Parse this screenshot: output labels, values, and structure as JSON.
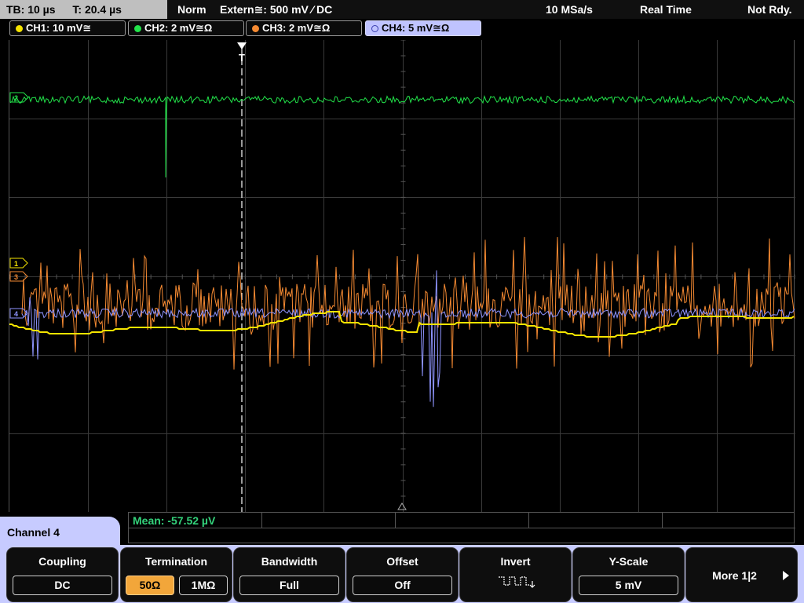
{
  "status": {
    "timebase": "TB: 10 µs",
    "trigger_time": "T: 20.4 µs",
    "mode": "Norm",
    "trigger_source": "Extern≅: 500 mV ⁄ DC",
    "sample_rate": "10 MSa/s",
    "acq_mode": "Real Time",
    "ready_state": "Not Rdy."
  },
  "channels": [
    {
      "label": "CH1: 10 mV≅",
      "color": "#f5e400"
    },
    {
      "label": "CH2: 2 mV≅Ω",
      "color": "#22e34a"
    },
    {
      "label": "CH3: 2 mV≅Ω",
      "color": "#f58a32"
    },
    {
      "label": "CH4: 5 mV≅Ω",
      "color": "#8f95ff"
    }
  ],
  "trace_markers": {
    "ch2": "2",
    "ch1": "1",
    "ch3": "3",
    "ch4": "4",
    "trigger": "T"
  },
  "measurement": {
    "mean": "Mean: -57.52 µV"
  },
  "panel": {
    "title": "Channel 4"
  },
  "softkeys": {
    "coupling": {
      "title": "Coupling",
      "value": "DC"
    },
    "termination": {
      "title": "Termination",
      "opt1": "50Ω",
      "opt2": "1MΩ"
    },
    "bandwidth": {
      "title": "Bandwidth",
      "value": "Full"
    },
    "offset": {
      "title": "Offset",
      "value": "Off"
    },
    "invert": {
      "title": "Invert"
    },
    "yscale": {
      "title": "Y-Scale",
      "value": "5 mV"
    },
    "more": {
      "label": "More 1|2"
    }
  },
  "colors": {
    "ch1": "#f5e400",
    "ch2": "#22e34a",
    "ch3": "#f58a32",
    "ch4": "#8f95ff",
    "grid": "#3a3a3a",
    "panel_accent": "#c7cbff",
    "selected_option": "#f2a63a"
  }
}
